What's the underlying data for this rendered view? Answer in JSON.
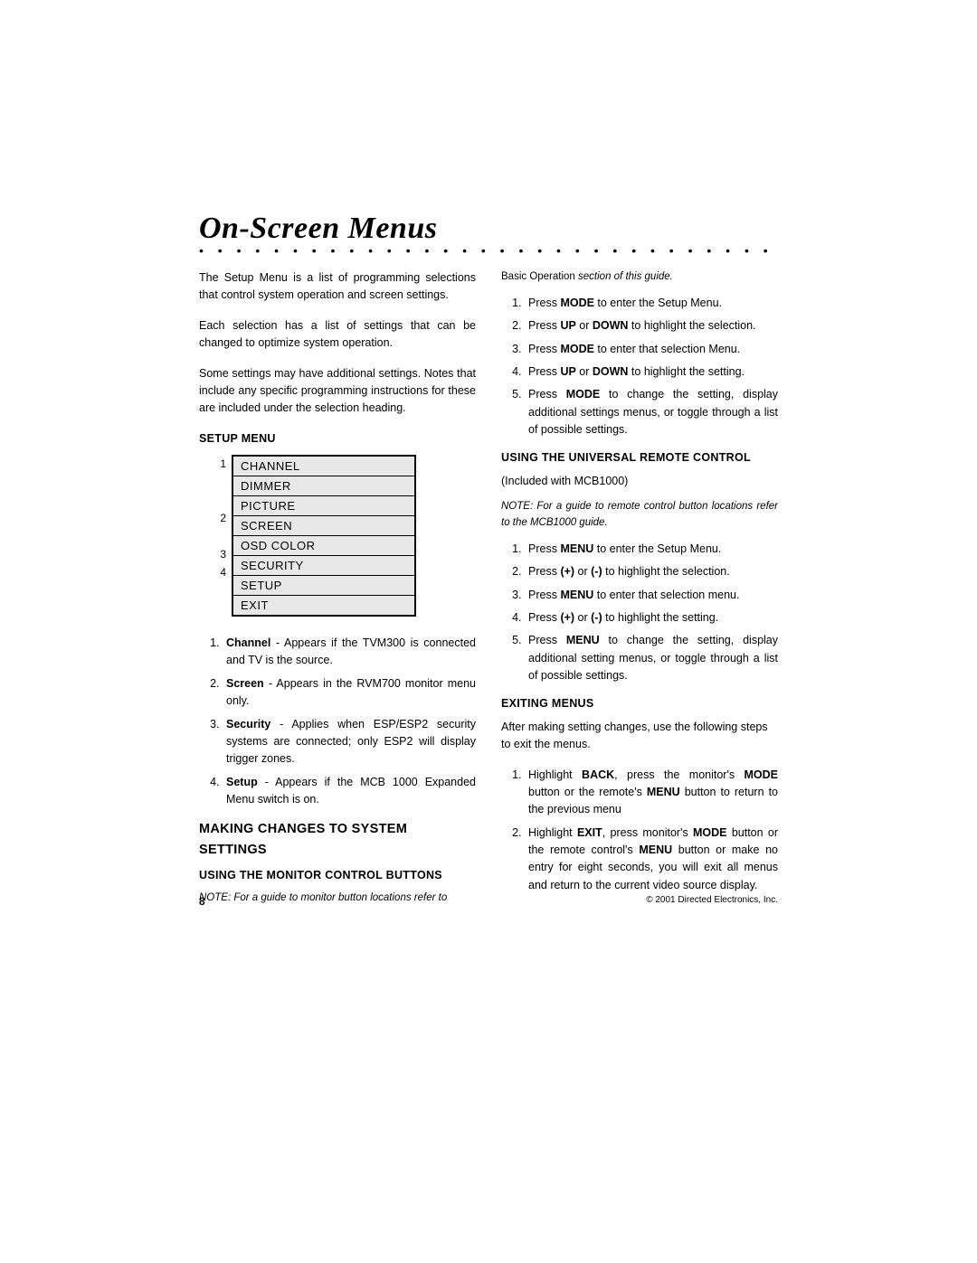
{
  "title": "On-Screen Menus",
  "col1": {
    "p1": "The Setup Menu is a list of programming selections that control system operation and screen settings.",
    "p2": "Each selection has a list of settings that can be changed to optimize system operation.",
    "p3": "Some settings may have additional settings. Notes that include any specific programming instructions for these are included under the selection heading.",
    "setup_head": "SETUP MENU",
    "menu_items": [
      "CHANNEL",
      "DIMMER",
      "PICTURE",
      "SCREEN",
      "OSD COLOR",
      "SECURITY",
      "SETUP",
      "EXIT"
    ],
    "menu_numbers": [
      "1",
      "",
      "",
      "2",
      "",
      "3",
      "4",
      ""
    ],
    "notes": [
      {
        "b": "Channel",
        "t": " - Appears if the TVM300 is connected and TV is the source."
      },
      {
        "b": "Screen",
        "t": " - Appears in the RVM700 monitor menu only."
      },
      {
        "b": "Security",
        "t": " - Applies when ESP/ESP2 security systems are connected; only ESP2 will display trigger zones."
      },
      {
        "b": "Setup",
        "t": " - Appears if the MCB 1000 Expanded Menu switch is on."
      }
    ],
    "making_head": "MAKING CHANGES TO SYSTEM SETTINGS",
    "using_monitor_head": "USING THE MONITOR CONTROL BUTTONS",
    "note1_a": "NOTE: For a guide to monitor button locations refer to"
  },
  "col2": {
    "cont_note": "Basic Operation",
    "cont_note_tail": " section of this guide.",
    "steps_monitor": [
      [
        {
          "t": "Press "
        },
        {
          "b": "MODE"
        },
        {
          "t": " to enter the Setup Menu."
        }
      ],
      [
        {
          "t": "Press "
        },
        {
          "b": "UP"
        },
        {
          "t": " or "
        },
        {
          "b": "DOWN"
        },
        {
          "t": " to highlight the selection."
        }
      ],
      [
        {
          "t": "Press "
        },
        {
          "b": "MODE"
        },
        {
          "t": " to enter that selection Menu."
        }
      ],
      [
        {
          "t": "Press "
        },
        {
          "b": "UP"
        },
        {
          "t": " or "
        },
        {
          "b": "DOWN"
        },
        {
          "t": " to highlight the setting."
        }
      ],
      [
        {
          "t": "Press "
        },
        {
          "b": "MODE"
        },
        {
          "t": " to change the setting, display additional settings menus, or toggle through a list of possible settings."
        }
      ]
    ],
    "using_remote_head": "USING THE UNIVERSAL REMOTE CONTROL",
    "included": "(Included with MCB1000)",
    "note2": "NOTE: For a guide to remote control button locations refer to the MCB1000 guide.",
    "steps_remote": [
      [
        {
          "t": "Press "
        },
        {
          "b": "MENU"
        },
        {
          "t": " to enter the Setup Menu."
        }
      ],
      [
        {
          "t": "Press "
        },
        {
          "b": "(+)"
        },
        {
          "t": " or "
        },
        {
          "b": "(-)"
        },
        {
          "t": " to highlight the selection."
        }
      ],
      [
        {
          "t": "Press "
        },
        {
          "b": "MENU"
        },
        {
          "t": " to enter that selection menu."
        }
      ],
      [
        {
          "t": "Press "
        },
        {
          "b": "(+)"
        },
        {
          "t": " or "
        },
        {
          "b": "(-)"
        },
        {
          "t": " to highlight the setting."
        }
      ],
      [
        {
          "t": "Press "
        },
        {
          "b": "MENU"
        },
        {
          "t": " to change the setting, display additional setting menus, or toggle through a list of possible settings."
        }
      ]
    ],
    "exiting_head": "EXITING MENUS",
    "exiting_intro": "After making setting changes, use the following steps to exit the menus.",
    "steps_exit": [
      [
        {
          "t": "Highlight "
        },
        {
          "b": "BACK"
        },
        {
          "t": ", press the monitor's "
        },
        {
          "b": "MODE"
        },
        {
          "t": " button or the remote's "
        },
        {
          "b": "MENU"
        },
        {
          "t": " button to return to the previous menu"
        }
      ],
      [
        {
          "t": "Highlight "
        },
        {
          "b": "EXIT"
        },
        {
          "t": ", press monitor's "
        },
        {
          "b": "MODE"
        },
        {
          "t": " button or the remote control's "
        },
        {
          "b": "MENU"
        },
        {
          "t": " button or make no entry for eight seconds, you will exit all menus and return to the current video source display."
        }
      ]
    ]
  },
  "footer": {
    "page": "8",
    "copyright": "© 2001 Directed Electronics, Inc."
  }
}
